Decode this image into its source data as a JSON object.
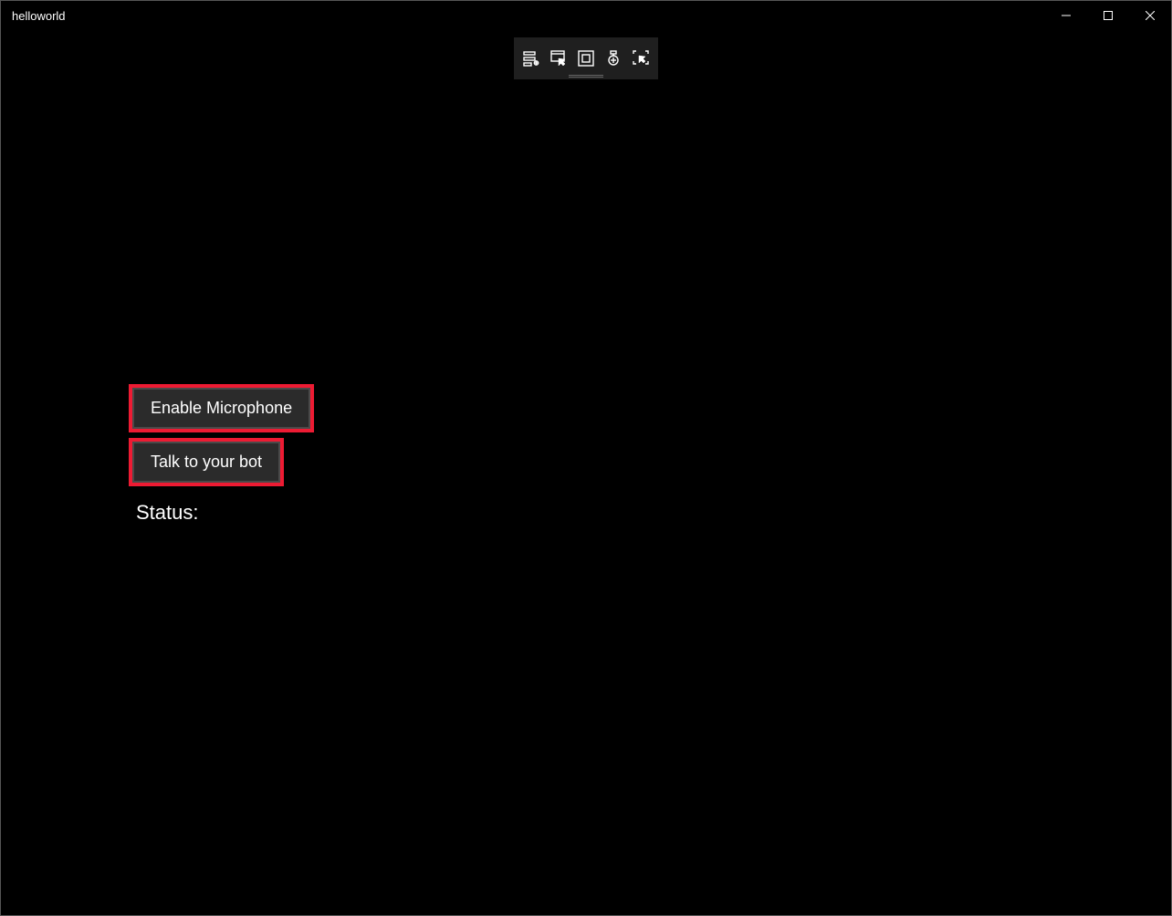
{
  "window": {
    "title": "helloworld"
  },
  "debug_toolbar": {
    "icons": [
      "debug-live-tree-icon",
      "debug-live-property-icon",
      "debug-select-element-icon",
      "debug-hot-reload-icon",
      "debug-display-options-icon"
    ]
  },
  "buttons": {
    "enable_mic": "Enable Microphone",
    "talk_bot": "Talk to your bot"
  },
  "labels": {
    "status": "Status:"
  },
  "colors": {
    "highlight": "#ed1b33",
    "button_bg": "#2b2b2b",
    "button_border": "#4a4a4a",
    "toolbar_bg": "#1f1f1f"
  }
}
